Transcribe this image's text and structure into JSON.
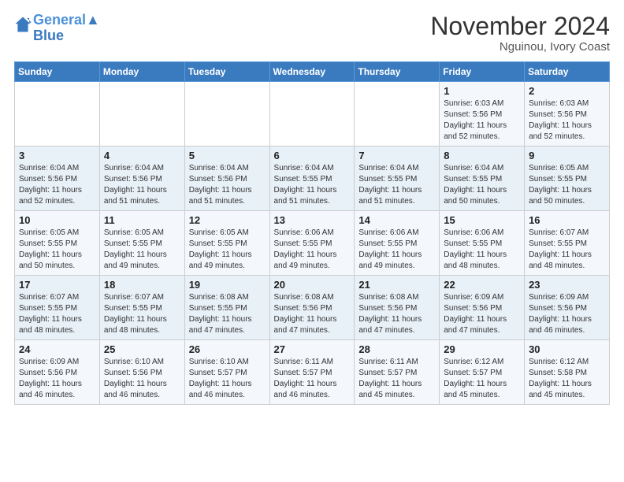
{
  "logo": {
    "line1": "General",
    "line2": "Blue"
  },
  "header": {
    "month_year": "November 2024",
    "location": "Nguinou, Ivory Coast"
  },
  "weekdays": [
    "Sunday",
    "Monday",
    "Tuesday",
    "Wednesday",
    "Thursday",
    "Friday",
    "Saturday"
  ],
  "weeks": [
    [
      {
        "day": "",
        "info": ""
      },
      {
        "day": "",
        "info": ""
      },
      {
        "day": "",
        "info": ""
      },
      {
        "day": "",
        "info": ""
      },
      {
        "day": "",
        "info": ""
      },
      {
        "day": "1",
        "info": "Sunrise: 6:03 AM\nSunset: 5:56 PM\nDaylight: 11 hours\nand 52 minutes."
      },
      {
        "day": "2",
        "info": "Sunrise: 6:03 AM\nSunset: 5:56 PM\nDaylight: 11 hours\nand 52 minutes."
      }
    ],
    [
      {
        "day": "3",
        "info": "Sunrise: 6:04 AM\nSunset: 5:56 PM\nDaylight: 11 hours\nand 52 minutes."
      },
      {
        "day": "4",
        "info": "Sunrise: 6:04 AM\nSunset: 5:56 PM\nDaylight: 11 hours\nand 51 minutes."
      },
      {
        "day": "5",
        "info": "Sunrise: 6:04 AM\nSunset: 5:56 PM\nDaylight: 11 hours\nand 51 minutes."
      },
      {
        "day": "6",
        "info": "Sunrise: 6:04 AM\nSunset: 5:55 PM\nDaylight: 11 hours\nand 51 minutes."
      },
      {
        "day": "7",
        "info": "Sunrise: 6:04 AM\nSunset: 5:55 PM\nDaylight: 11 hours\nand 51 minutes."
      },
      {
        "day": "8",
        "info": "Sunrise: 6:04 AM\nSunset: 5:55 PM\nDaylight: 11 hours\nand 50 minutes."
      },
      {
        "day": "9",
        "info": "Sunrise: 6:05 AM\nSunset: 5:55 PM\nDaylight: 11 hours\nand 50 minutes."
      }
    ],
    [
      {
        "day": "10",
        "info": "Sunrise: 6:05 AM\nSunset: 5:55 PM\nDaylight: 11 hours\nand 50 minutes."
      },
      {
        "day": "11",
        "info": "Sunrise: 6:05 AM\nSunset: 5:55 PM\nDaylight: 11 hours\nand 49 minutes."
      },
      {
        "day": "12",
        "info": "Sunrise: 6:05 AM\nSunset: 5:55 PM\nDaylight: 11 hours\nand 49 minutes."
      },
      {
        "day": "13",
        "info": "Sunrise: 6:06 AM\nSunset: 5:55 PM\nDaylight: 11 hours\nand 49 minutes."
      },
      {
        "day": "14",
        "info": "Sunrise: 6:06 AM\nSunset: 5:55 PM\nDaylight: 11 hours\nand 49 minutes."
      },
      {
        "day": "15",
        "info": "Sunrise: 6:06 AM\nSunset: 5:55 PM\nDaylight: 11 hours\nand 48 minutes."
      },
      {
        "day": "16",
        "info": "Sunrise: 6:07 AM\nSunset: 5:55 PM\nDaylight: 11 hours\nand 48 minutes."
      }
    ],
    [
      {
        "day": "17",
        "info": "Sunrise: 6:07 AM\nSunset: 5:55 PM\nDaylight: 11 hours\nand 48 minutes."
      },
      {
        "day": "18",
        "info": "Sunrise: 6:07 AM\nSunset: 5:55 PM\nDaylight: 11 hours\nand 48 minutes."
      },
      {
        "day": "19",
        "info": "Sunrise: 6:08 AM\nSunset: 5:55 PM\nDaylight: 11 hours\nand 47 minutes."
      },
      {
        "day": "20",
        "info": "Sunrise: 6:08 AM\nSunset: 5:56 PM\nDaylight: 11 hours\nand 47 minutes."
      },
      {
        "day": "21",
        "info": "Sunrise: 6:08 AM\nSunset: 5:56 PM\nDaylight: 11 hours\nand 47 minutes."
      },
      {
        "day": "22",
        "info": "Sunrise: 6:09 AM\nSunset: 5:56 PM\nDaylight: 11 hours\nand 47 minutes."
      },
      {
        "day": "23",
        "info": "Sunrise: 6:09 AM\nSunset: 5:56 PM\nDaylight: 11 hours\nand 46 minutes."
      }
    ],
    [
      {
        "day": "24",
        "info": "Sunrise: 6:09 AM\nSunset: 5:56 PM\nDaylight: 11 hours\nand 46 minutes."
      },
      {
        "day": "25",
        "info": "Sunrise: 6:10 AM\nSunset: 5:56 PM\nDaylight: 11 hours\nand 46 minutes."
      },
      {
        "day": "26",
        "info": "Sunrise: 6:10 AM\nSunset: 5:57 PM\nDaylight: 11 hours\nand 46 minutes."
      },
      {
        "day": "27",
        "info": "Sunrise: 6:11 AM\nSunset: 5:57 PM\nDaylight: 11 hours\nand 46 minutes."
      },
      {
        "day": "28",
        "info": "Sunrise: 6:11 AM\nSunset: 5:57 PM\nDaylight: 11 hours\nand 45 minutes."
      },
      {
        "day": "29",
        "info": "Sunrise: 6:12 AM\nSunset: 5:57 PM\nDaylight: 11 hours\nand 45 minutes."
      },
      {
        "day": "30",
        "info": "Sunrise: 6:12 AM\nSunset: 5:58 PM\nDaylight: 11 hours\nand 45 minutes."
      }
    ]
  ]
}
